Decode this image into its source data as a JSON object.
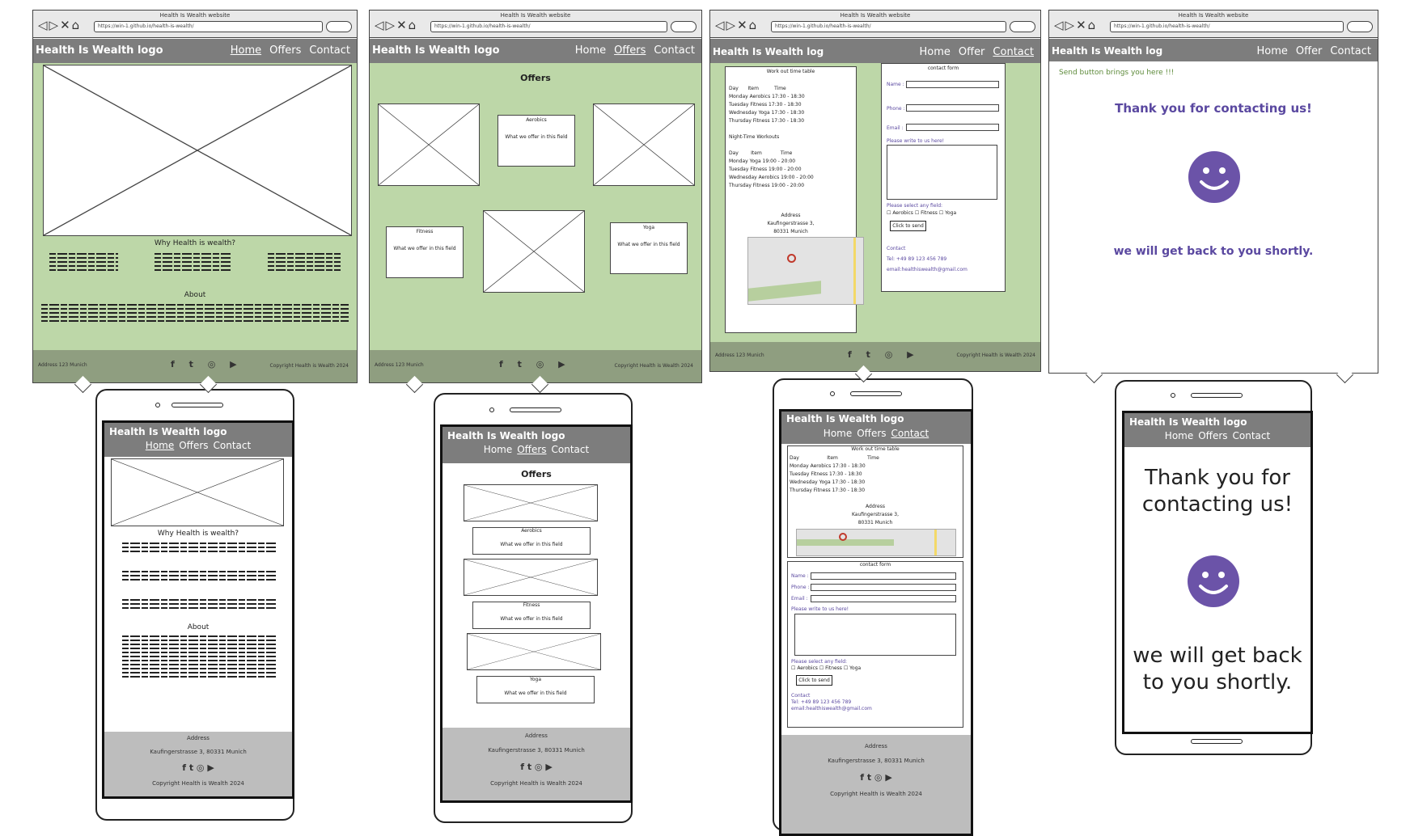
{
  "brand": {
    "logo": "Health Is Wealth logo",
    "logo_short": "Health Is Wealth log"
  },
  "browser": {
    "window_title": "Health Is Wealth website",
    "url": "https://win-1.github.io/health-is-wealth/"
  },
  "nav": {
    "home": "Home",
    "offers": "Offers",
    "offer": "Offer",
    "contact": "Contact"
  },
  "home": {
    "why_title": "Why Health is wealth?",
    "about_title": "About"
  },
  "offers": {
    "title": "Offers",
    "aerobics": "Aerobics",
    "fitness": "Fitness",
    "yoga": "Yoga",
    "desc": "What we offer in this field"
  },
  "contact": {
    "timetable_title": "Work out time table",
    "col_day": "Day",
    "col_item": "Item",
    "col_time": "Time",
    "rows": [
      "Monday   Aerobics   17:30 - 18:30",
      "Tuesday    Fitness    17:30 - 18:30",
      "Wednesday  Yoga     17:30 - 18:30",
      "Thursday  Fitness  17:30 - 18:30"
    ],
    "night_title": "Night-Time Workouts",
    "night_rows": [
      "Monday Yoga 19:00 - 20:00",
      "Tuesday Fitness 19:00 - 20:00",
      "Wednesday Aerobics 19:00 - 20:00",
      "Thursday Fitness 19:00 - 20:00"
    ],
    "address_label": "Address",
    "address_line1": "Kaufingerstrasse 3,",
    "address_line2": "80331 Munich",
    "form_title": "contact form",
    "name": "Name :",
    "phone": "Phone :",
    "email": "Email :",
    "message": "Please write to us here!",
    "select": "Please select any field:",
    "opt_aerobics": "Aerobics",
    "opt_fitness": "Fitness",
    "opt_yoga": "Yoga",
    "send": "Click to send",
    "contact_label": "Contact",
    "tel": "Tel: +49 89 123 456 789",
    "mail": "email:healthiswealth@gmail.com"
  },
  "thanks": {
    "note": "Send button brings you here !!!",
    "line1": "Thank you for contacting us!",
    "line2": "we will get back to you shortly.",
    "m_line1": "Thank you for contacting us!",
    "m_line2": "we will get back to you shortly."
  },
  "footer": {
    "address_short": "Address 123 Munich",
    "copyright": "Copyright Health is Wealth 2024",
    "address_label": "Address",
    "address_full": "Kaufingerstrasse 3, 80331 Munich",
    "social": "f  t  ◎  ▶"
  }
}
